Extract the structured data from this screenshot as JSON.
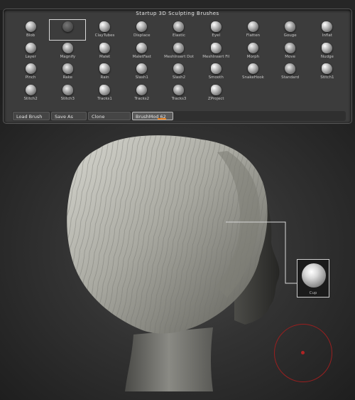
{
  "palette": {
    "title": "Startup 3D Sculpting Brushes",
    "brushes": [
      {
        "label": "Blob",
        "icon": "blob-brush-icon"
      },
      {
        "label": "",
        "icon": "selected-brush-icon",
        "selected": true
      },
      {
        "label": "ClayTubes",
        "icon": "claytubes-brush-icon"
      },
      {
        "label": "Displace",
        "icon": "displace-brush-icon"
      },
      {
        "label": "Elastic",
        "icon": "elastic-brush-icon"
      },
      {
        "label": "Eyel",
        "icon": "eyel-brush-icon"
      },
      {
        "label": "Flatten",
        "icon": "flatten-brush-icon"
      },
      {
        "label": "Gouge",
        "icon": "gouge-brush-icon"
      },
      {
        "label": "Inflat",
        "icon": "inflat-brush-icon"
      },
      {
        "label": "Layer",
        "icon": "layer-brush-icon"
      },
      {
        "label": "Magnify",
        "icon": "magnify-brush-icon"
      },
      {
        "label": "Malet",
        "icon": "malet-brush-icon"
      },
      {
        "label": "MaletFast",
        "icon": "maletfast-brush-icon"
      },
      {
        "label": "MeshInsert Dot",
        "icon": "meshinsert-dot-brush-icon"
      },
      {
        "label": "MeshInsert Fil",
        "icon": "meshinsert-fil-brush-icon"
      },
      {
        "label": "Morph",
        "icon": "morph-brush-icon"
      },
      {
        "label": "Move",
        "icon": "move-brush-icon"
      },
      {
        "label": "Nudge",
        "icon": "nudge-brush-icon"
      },
      {
        "label": "Pinch",
        "icon": "pinch-brush-icon"
      },
      {
        "label": "Rake",
        "icon": "rake-brush-icon"
      },
      {
        "label": "Rain",
        "icon": "rain-brush-icon"
      },
      {
        "label": "Slash1",
        "icon": "slash1-brush-icon"
      },
      {
        "label": "Slash2",
        "icon": "slash2-brush-icon"
      },
      {
        "label": "Smooth",
        "icon": "smooth-brush-icon"
      },
      {
        "label": "SnakeHook",
        "icon": "snakehook-brush-icon"
      },
      {
        "label": "Standard",
        "icon": "standard-brush-icon"
      },
      {
        "label": "Stitch1",
        "icon": "stitch1-brush-icon"
      },
      {
        "label": "Stitch2",
        "icon": "stitch2-brush-icon"
      },
      {
        "label": "Stitch3",
        "icon": "stitch3-brush-icon"
      },
      {
        "label": "Tracks1",
        "icon": "tracks1-brush-icon"
      },
      {
        "label": "Tracks2",
        "icon": "tracks2-brush-icon"
      },
      {
        "label": "Tracks3",
        "icon": "tracks3-brush-icon"
      },
      {
        "label": "ZProject",
        "icon": "zproject-brush-icon"
      }
    ]
  },
  "buttons": {
    "load": "Load Brush",
    "save": "Save As",
    "clone": "Clone",
    "brushmod": "BrushMod 62"
  },
  "brushmod_value": 62,
  "preview": {
    "label": "Cup",
    "icon": "brush-preview-icon"
  },
  "colors": {
    "accent_orange": "#e27a17",
    "cursor_red": "#9a1f1f"
  }
}
